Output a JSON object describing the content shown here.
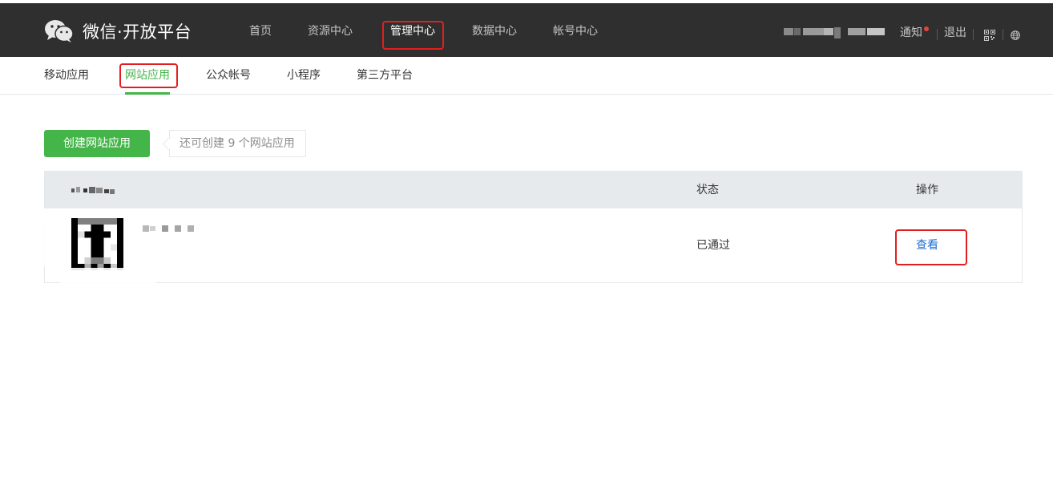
{
  "brand": {
    "title": "微信·开放平台",
    "icon": "wechat-logo-icon"
  },
  "top_nav": [
    {
      "label": "首页",
      "active": false
    },
    {
      "label": "资源中心",
      "active": false
    },
    {
      "label": "管理中心",
      "active": true
    },
    {
      "label": "数据中心",
      "active": false
    },
    {
      "label": "帐号中心",
      "active": false
    }
  ],
  "top_right": {
    "notify_label": "通知",
    "logout_label": "退出",
    "qrcode_icon": "qrcode-icon",
    "language_icon": "globe-icon"
  },
  "sub_nav": [
    {
      "label": "移动应用",
      "active": false
    },
    {
      "label": "网站应用",
      "active": true
    },
    {
      "label": "公众帐号",
      "active": false
    },
    {
      "label": "小程序",
      "active": false
    },
    {
      "label": "第三方平台",
      "active": false
    }
  ],
  "actions": {
    "create_label": "创建网站应用",
    "remaining_tip": "还可创建 9 个网站应用"
  },
  "table": {
    "headers": {
      "status": "状态",
      "operation": "操作"
    },
    "rows": [
      {
        "status": "已通过",
        "action": "查看"
      }
    ]
  },
  "colors": {
    "accent": "#44b549",
    "topbar": "#2f2f2f",
    "link": "#1e6fce",
    "highlight": "#e02020"
  }
}
